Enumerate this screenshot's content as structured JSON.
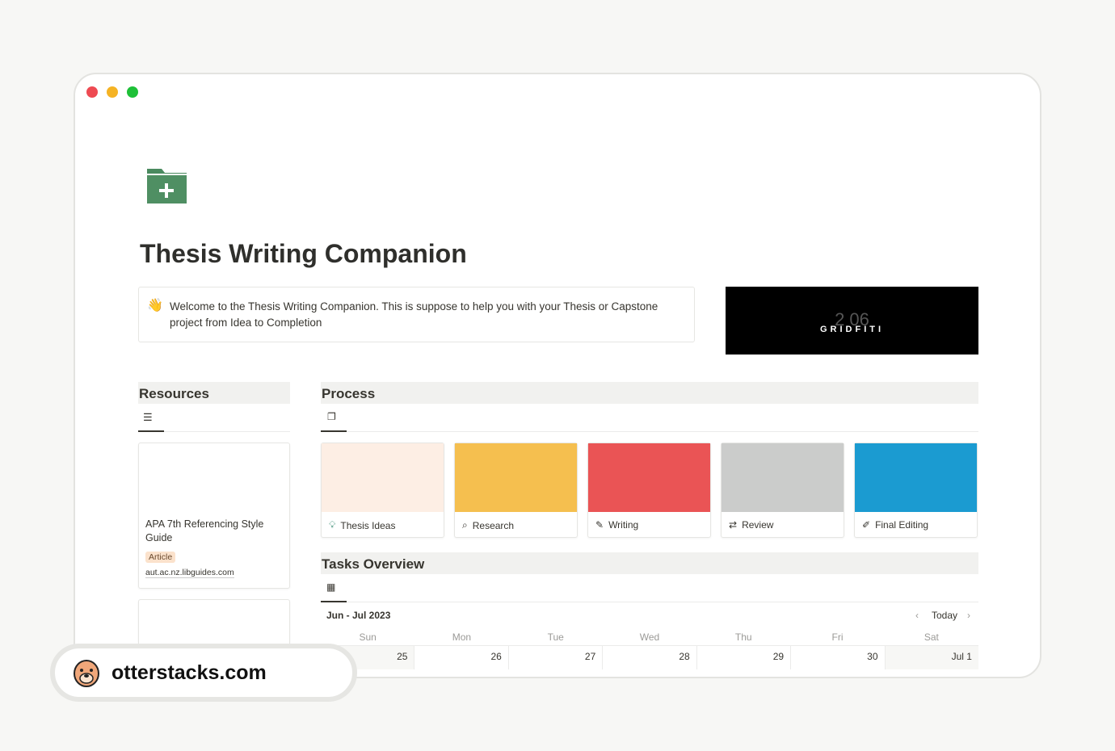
{
  "page": {
    "title": "Thesis Writing Companion",
    "icon": "folder-plus-icon",
    "callout_icon": "waving-hand-icon",
    "callout": "Welcome to the Thesis Writing Companion. This is suppose to help you with your Thesis or Capstone project from Idea to Completion"
  },
  "banner": {
    "text": "GRIDFITI",
    "time": "2 06"
  },
  "resources": {
    "heading": "Resources",
    "view_icon": "database-icon",
    "items": [
      {
        "title": "APA 7th Referencing Style Guide",
        "tag": "Article",
        "url": "aut.ac.nz.libguides.com"
      }
    ]
  },
  "process": {
    "heading": "Process",
    "view_icon": "gallery-icon",
    "cards": [
      {
        "label": "Thesis Ideas",
        "icon": "lightbulb-icon",
        "color": "#fdeee4"
      },
      {
        "label": "Research",
        "icon": "search-icon",
        "color": "#f5bf4f"
      },
      {
        "label": "Writing",
        "icon": "edit-icon",
        "color": "#ea5455"
      },
      {
        "label": "Review",
        "icon": "swap-icon",
        "color": "#cbcccb"
      },
      {
        "label": "Final Editing",
        "icon": "pen-icon",
        "color": "#1b9bd1"
      }
    ]
  },
  "tasks": {
    "heading": "Tasks Overview",
    "view_icon": "calendar-icon",
    "range": "Jun - Jul 2023",
    "today": "Today",
    "weekdays": [
      "Sun",
      "Mon",
      "Tue",
      "Wed",
      "Thu",
      "Fri",
      "Sat"
    ],
    "days": [
      "25",
      "26",
      "27",
      "28",
      "29",
      "30",
      "Jul 1"
    ]
  },
  "watermark": {
    "text": "otterstacks.com"
  }
}
